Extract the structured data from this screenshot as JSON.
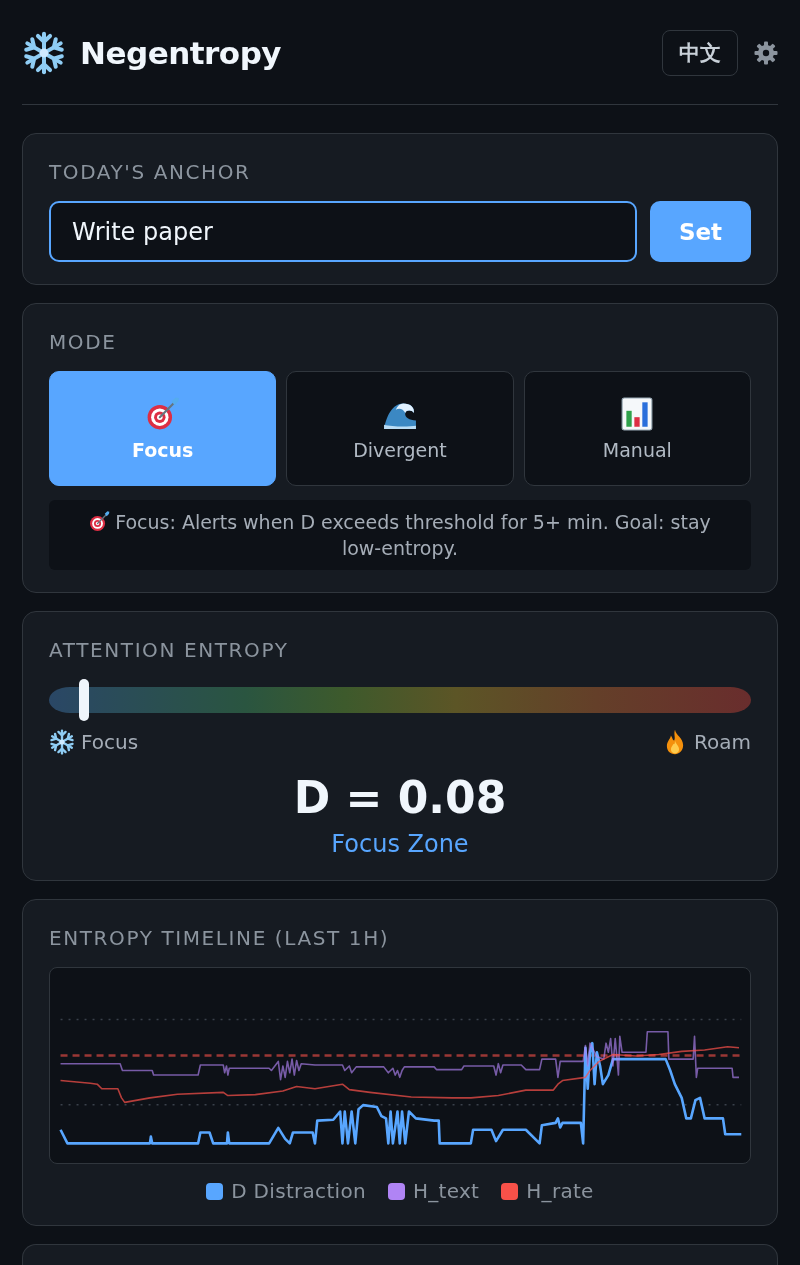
{
  "header": {
    "title": "Negentropy",
    "language_button": "中文"
  },
  "anchor_card": {
    "heading": "TODAY'S ANCHOR",
    "input": {
      "value": "Write paper"
    },
    "button": "Set"
  },
  "mode_card": {
    "heading": "MODE",
    "modes": [
      {
        "label": "Focus",
        "selected": true
      },
      {
        "label": "Divergent",
        "selected": false
      },
      {
        "label": "Manual",
        "selected": false
      }
    ],
    "description": "Focus: Alerts when D exceeds threshold for 5+ min. Goal: stay low-entropy."
  },
  "entropy_card": {
    "heading": "ATTENTION ENTROPY",
    "meter": {
      "level": 0.05
    },
    "low_label": "Focus",
    "high_label": "Roam",
    "reading": "D = 0.08",
    "zone": "Focus Zone"
  },
  "timeline_card": {
    "heading": "ENTROPY TIMELINE (LAST 1H)",
    "legend": [
      {
        "label": "D Distraction",
        "color": "#58a6ff"
      },
      {
        "label": "H_text",
        "color": "#b084f5"
      },
      {
        "label": "H_rate",
        "color": "#f85149"
      }
    ]
  }
}
